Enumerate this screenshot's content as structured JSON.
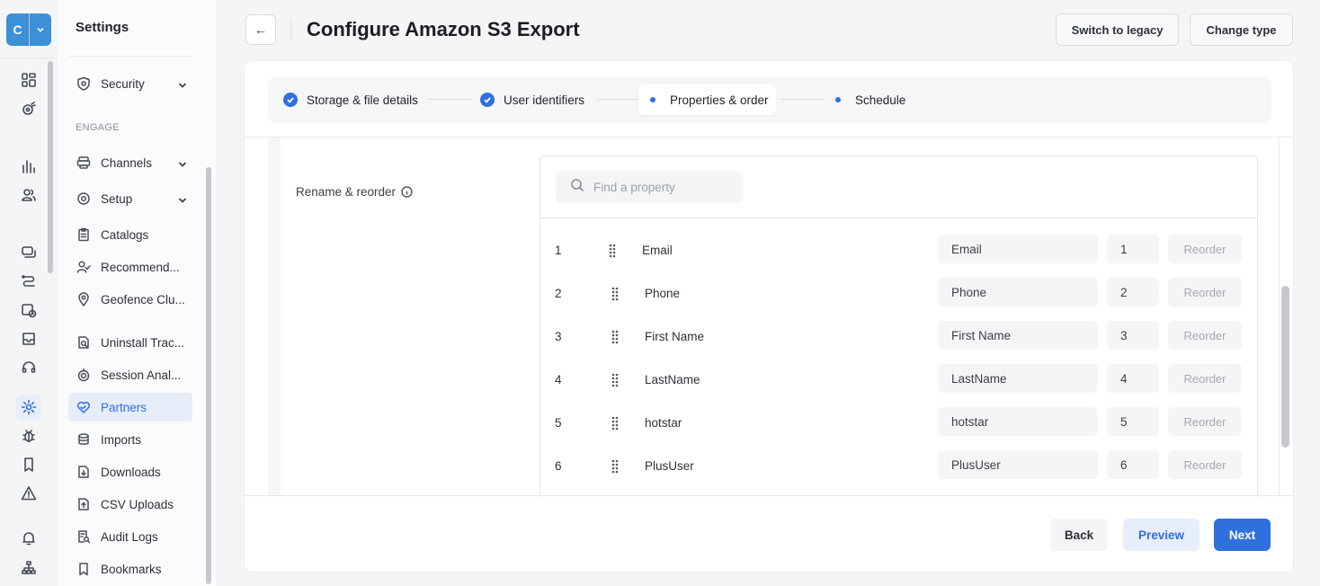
{
  "logo": {
    "letter": "C"
  },
  "sidebar": {
    "title": "Settings",
    "section_engage": "ENGAGE",
    "items": [
      {
        "label": "Security",
        "icon": "shield-icon",
        "expandable": true
      },
      {
        "label": "Channels",
        "icon": "channels-icon",
        "expandable": true
      },
      {
        "label": "Setup",
        "icon": "gear-icon",
        "expandable": true
      },
      {
        "label": "Catalogs",
        "icon": "clipboard-icon"
      },
      {
        "label": "Recommend...",
        "icon": "user-check-icon"
      },
      {
        "label": "Geofence Clu...",
        "icon": "location-pin-icon"
      },
      {
        "label": "Uninstall Trac...",
        "icon": "search-doc-icon"
      },
      {
        "label": "Session Anal...",
        "icon": "target-icon"
      },
      {
        "label": "Partners",
        "icon": "heart-handshake-icon",
        "active": true
      },
      {
        "label": "Imports",
        "icon": "database-icon"
      },
      {
        "label": "Downloads",
        "icon": "download-file-icon"
      },
      {
        "label": "CSV Uploads",
        "icon": "upload-file-icon"
      },
      {
        "label": "Audit Logs",
        "icon": "audit-search-icon"
      },
      {
        "label": "Bookmarks",
        "icon": "bookmark-icon"
      }
    ]
  },
  "header": {
    "back_glyph": "←",
    "title": "Configure Amazon S3 Export",
    "switch_legacy": "Switch to legacy",
    "change_type": "Change type"
  },
  "steps": [
    {
      "label": "Storage & file details",
      "state": "done"
    },
    {
      "label": "User identifiers",
      "state": "done"
    },
    {
      "label": "Properties & order",
      "state": "current"
    },
    {
      "label": "Schedule",
      "state": "pending"
    }
  ],
  "rename_reorder": {
    "label": "Rename & reorder",
    "search_placeholder": "Find a property",
    "reorder_label": "Reorder",
    "rows": [
      {
        "num": "1",
        "name": "Email",
        "rename": "Email",
        "order": "1"
      },
      {
        "num": "2",
        "name": "Phone",
        "rename": "Phone",
        "order": "2"
      },
      {
        "num": "3",
        "name": "First Name",
        "rename": "First Name",
        "order": "3"
      },
      {
        "num": "4",
        "name": "LastName",
        "rename": "LastName",
        "order": "4"
      },
      {
        "num": "5",
        "name": "hotstar",
        "rename": "hotstar",
        "order": "5"
      },
      {
        "num": "6",
        "name": "PlusUser",
        "rename": "PlusUser",
        "order": "6"
      }
    ]
  },
  "footer": {
    "back": "Back",
    "preview": "Preview",
    "next": "Next"
  },
  "colors": {
    "accent": "#2f6fde",
    "logo": "#3d8fd6"
  }
}
